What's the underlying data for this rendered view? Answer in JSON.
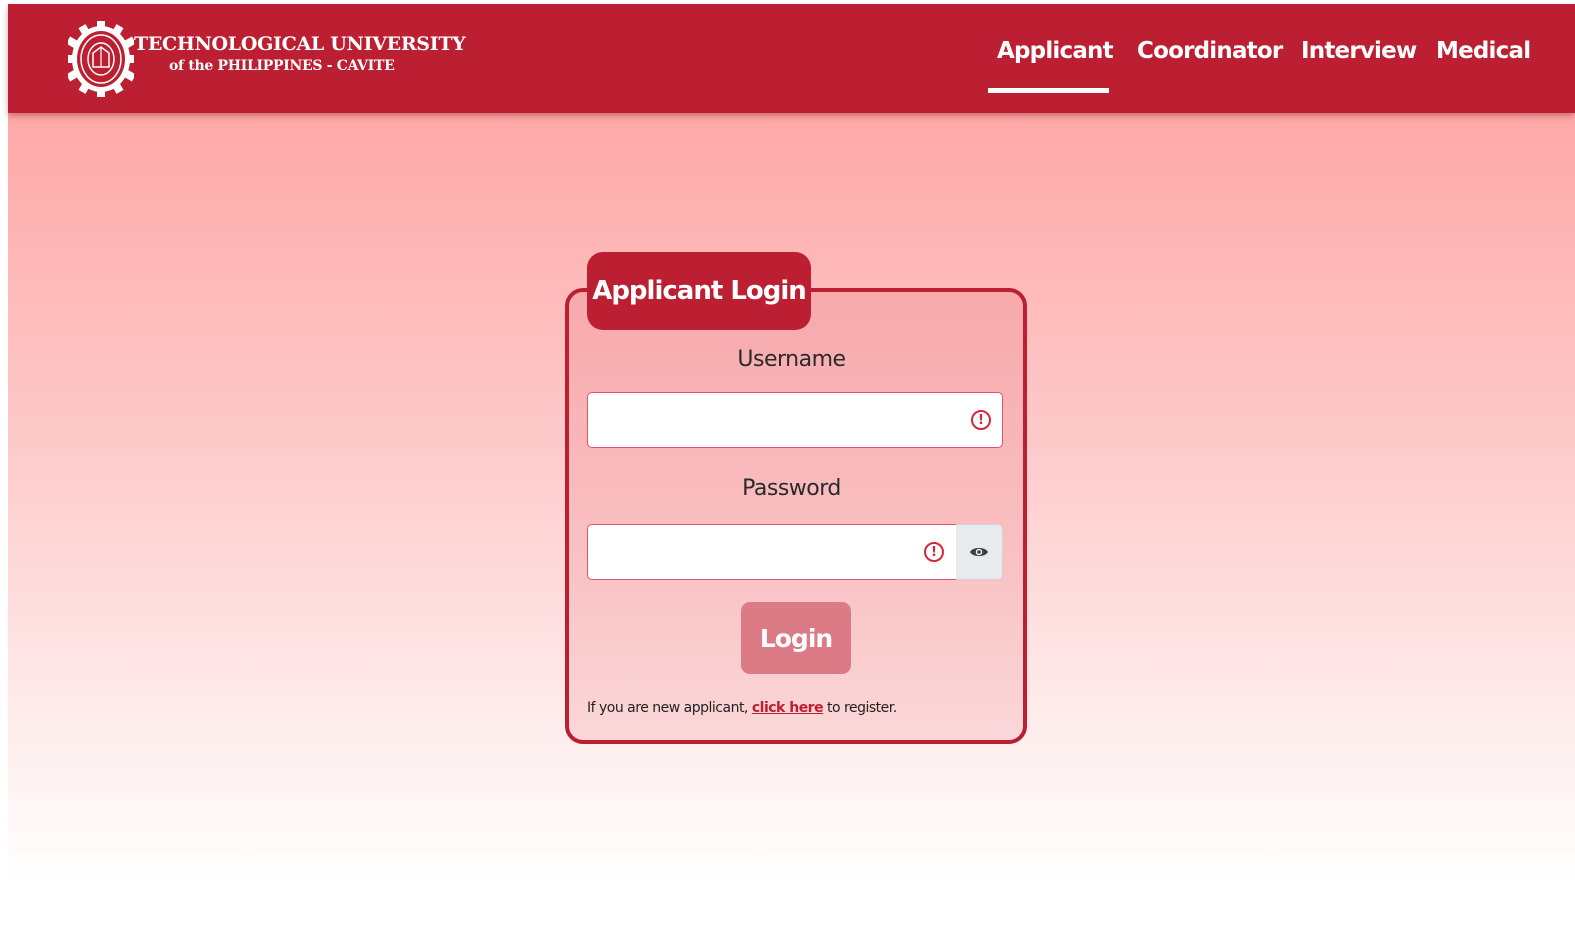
{
  "header": {
    "logo_line1": "TECHNOLOGICAL UNIVERSITY",
    "logo_line2": "of the PHILIPPINES - CAVITE",
    "nav": [
      {
        "label": "Applicant",
        "active": true
      },
      {
        "label": "Coordinator",
        "active": false
      },
      {
        "label": "Interview",
        "active": false
      },
      {
        "label": "Medical",
        "active": false
      }
    ]
  },
  "login": {
    "title": "Applicant Login",
    "username_label": "Username",
    "username_value": "",
    "password_label": "Password",
    "password_value": "",
    "invalid_icon": "exclamation-circle-icon",
    "toggle_icon": "eye-icon",
    "button_label": "Login",
    "register_prefix": "If you are new applicant, ",
    "register_link": "click here",
    "register_suffix": " to register."
  },
  "colors": {
    "brand": "#bc1f31",
    "button": "#dc7a85",
    "error": "#d7263d"
  }
}
